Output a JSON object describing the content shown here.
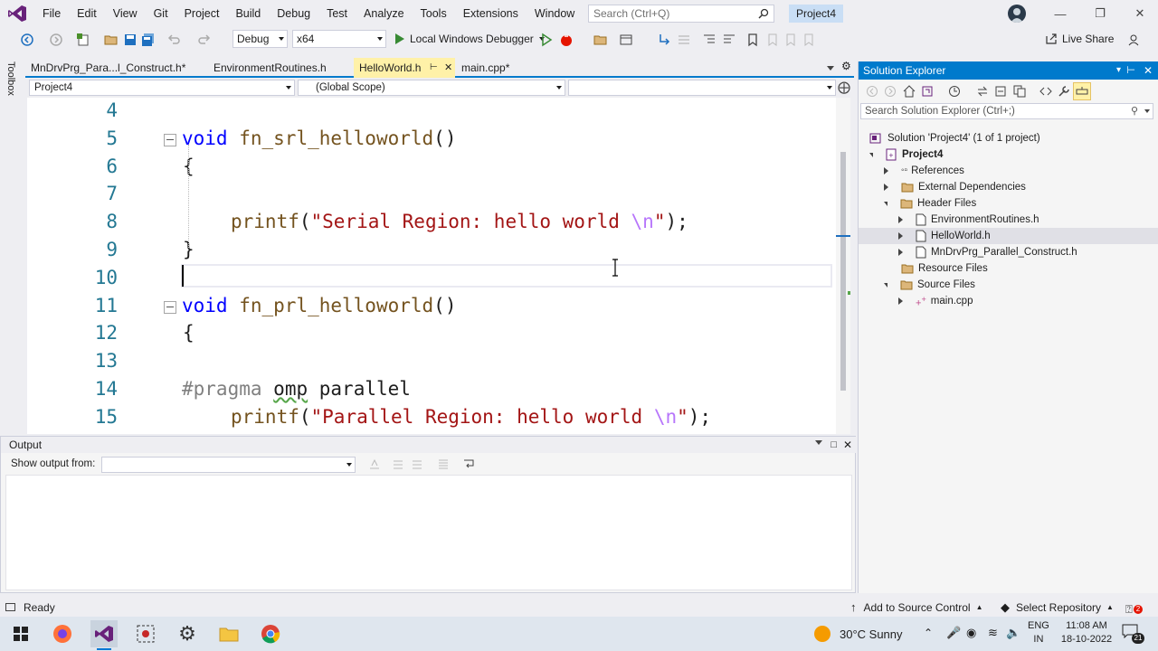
{
  "menubar": {
    "items": [
      "File",
      "Edit",
      "View",
      "Git",
      "Project",
      "Build",
      "Debug",
      "Test",
      "Analyze",
      "Tools",
      "Extensions",
      "Window",
      "Help"
    ],
    "search_placeholder": "Search (Ctrl+Q)",
    "project_title": "Project4"
  },
  "toolbar": {
    "configuration": "Debug",
    "platform": "x64",
    "debugger_label": "Local Windows Debugger",
    "live_share": "Live Share"
  },
  "toolbox": {
    "label": "Toolbox"
  },
  "doc_tabs": [
    {
      "label": "MnDrvPrg_Para...l_Construct.h*",
      "active": false
    },
    {
      "label": "EnvironmentRoutines.h",
      "active": false
    },
    {
      "label": "HelloWorld.h",
      "active": true
    },
    {
      "label": "main.cpp*",
      "active": false
    }
  ],
  "navbar": {
    "project": "Project4",
    "scope": "(Global Scope)",
    "member": ""
  },
  "editor": {
    "line_numbers": [
      "4",
      "5",
      "6",
      "7",
      "8",
      "9",
      "10",
      "11",
      "12",
      "13",
      "14",
      "15"
    ],
    "lines": [
      {
        "kind": "empty"
      },
      {
        "kind": "func",
        "kw": "void",
        "name": "fn_srl_helloworld",
        "rest": "()"
      },
      {
        "kind": "plain",
        "text": "{"
      },
      {
        "kind": "empty"
      },
      {
        "kind": "printf",
        "fn": "printf",
        "open": "(",
        "str": "\"Serial Region: hello world ",
        "esc": "\\n",
        "strend": "\"",
        "close": ");"
      },
      {
        "kind": "plain",
        "text": "}"
      },
      {
        "kind": "empty"
      },
      {
        "kind": "func",
        "kw": "void",
        "name": "fn_prl_helloworld",
        "rest": "()"
      },
      {
        "kind": "plain",
        "text": "{"
      },
      {
        "kind": "empty"
      },
      {
        "kind": "pragma",
        "pp": "#pragma",
        "a": "omp",
        "b": "parallel"
      },
      {
        "kind": "printf",
        "fn": "printf",
        "open": "(",
        "str": "\"Parallel Region: hello world ",
        "esc": "\\n",
        "strend": "\"",
        "close": ");"
      }
    ]
  },
  "output": {
    "title": "Output",
    "show_from_label": "Show output from:",
    "source": ""
  },
  "solution_explorer": {
    "title": "Solution Explorer",
    "search_placeholder": "Search Solution Explorer (Ctrl+;)",
    "solution": "Solution 'Project4' (1 of 1 project)",
    "project": "Project4",
    "references": "References",
    "external": "External Dependencies",
    "header_files": "Header Files",
    "header_items": [
      "EnvironmentRoutines.h",
      "HelloWorld.h",
      "MnDrvPrg_Parallel_Construct.h"
    ],
    "resource_files": "Resource Files",
    "source_files": "Source Files",
    "source_items": [
      "main.cpp"
    ]
  },
  "statusbar": {
    "ready": "Ready",
    "source_control": "Add to Source Control",
    "repository": "Select Repository",
    "notifications": "2"
  },
  "taskbar": {
    "weather": "30°C  Sunny",
    "lang1": "ENG",
    "lang2": "IN",
    "time": "11:08 AM",
    "date": "18-10-2022",
    "notif_count": "21"
  },
  "colors": {
    "accent": "#007acc",
    "vs_purple": "#68217a",
    "keyword": "#0000ff",
    "string": "#a31515",
    "function": "#74531f"
  }
}
